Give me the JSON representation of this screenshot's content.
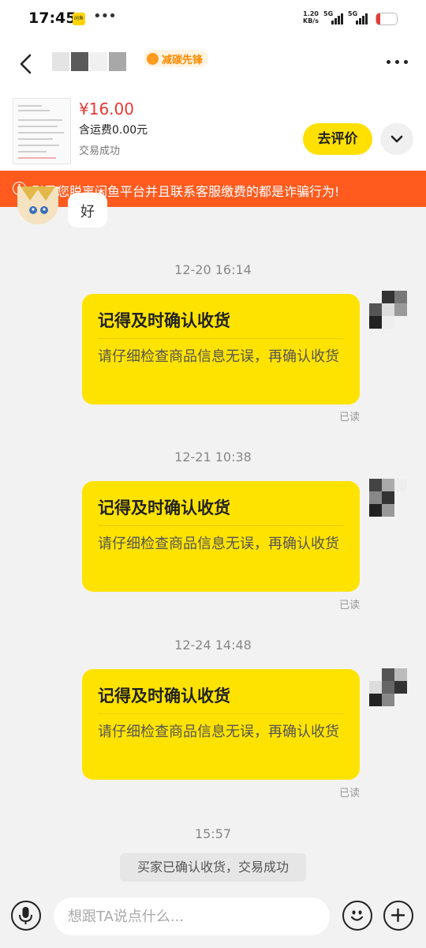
{
  "status_bar": {
    "time": "17:45",
    "net_speed_value": "1.20",
    "net_speed_unit": "KB/s",
    "signal_1": "5G",
    "signal_2": "5G",
    "battery": "19",
    "battery_level_percent": 19,
    "app_icon": "xianyu-app-icon",
    "more_icon": "ellipsis-icon"
  },
  "header": {
    "back_icon": "back-arrow-icon",
    "badge_label": "减碳先锋",
    "badge_icon": "leaf-badge-icon",
    "more_icon": "more-dots-icon"
  },
  "product": {
    "price": "¥16.00",
    "shipping": "含运费0.00元",
    "status": "交易成功",
    "review_button": "去评价",
    "expand_icon": "chevron-down-icon"
  },
  "warning": {
    "text": "引导您脱离闲鱼平台并且联系客服缴费的都是诈骗行为!",
    "icon": "alert-circle-icon"
  },
  "messages": {
    "peer_reply": "好",
    "items": [
      {
        "timestamp": "12-20 16:14",
        "title": "记得及时确认收货",
        "body": "请仔细检查商品信息无误，再确认收货",
        "read": "已读"
      },
      {
        "timestamp": "12-21 10:38",
        "title": "记得及时确认收货",
        "body": "请仔细检查商品信息无误，再确认收货",
        "read": "已读"
      },
      {
        "timestamp": "12-24 14:48",
        "title": "记得及时确认收货",
        "body": "请仔细检查商品信息无误，再确认收货",
        "read": "已读"
      }
    ],
    "final_timestamp": "15:57",
    "system_message": "买家已确认收货，交易成功"
  },
  "input_bar": {
    "placeholder": "想跟TA说点什么...",
    "value": "",
    "voice_icon": "microphone-icon",
    "emoji_icon": "emoji-icon",
    "add_icon": "plus-icon"
  },
  "colors": {
    "accent_yellow": "#ffe300",
    "price_red": "#e53935",
    "warning_orange": "#ff5b1f",
    "badge_orange": "#ff8a00"
  }
}
